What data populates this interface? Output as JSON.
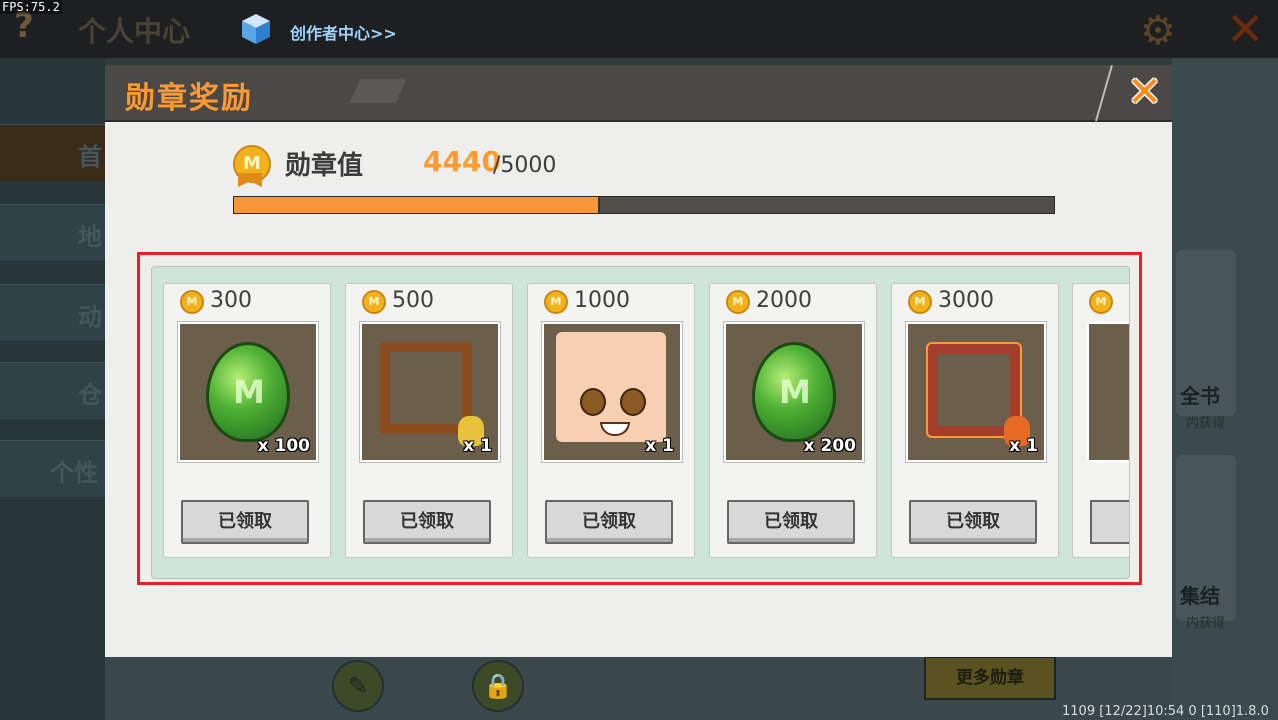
{
  "fps": "FPS:75.2",
  "top_bar": {
    "title": "个人中心",
    "creator_link": "创作者中心>>"
  },
  "background": {
    "nav_items": [
      "首",
      "地",
      "动",
      "仓",
      "个性"
    ],
    "side_cards": [
      {
        "label": "全书",
        "sub": "内获得"
      },
      {
        "label": "集结",
        "sub": "内获得"
      }
    ],
    "more_medals_button": "更多勋章",
    "version_text": "1109  [12/22]10:54 0  [110]1.8.0"
  },
  "dialog": {
    "title": "勋章奖励",
    "medal_label": "勋章值",
    "current_value": "4440",
    "max_value": "/5000",
    "progress": 0.444,
    "rewards": [
      {
        "cost": "300",
        "item": "green-egg",
        "quantity": "x 100",
        "button": "已领取"
      },
      {
        "cost": "500",
        "item": "wood-frame",
        "quantity": "x 1",
        "button": "已领取"
      },
      {
        "cost": "1000",
        "item": "face-avatar",
        "quantity": "x 1",
        "button": "已领取"
      },
      {
        "cost": "2000",
        "item": "green-egg",
        "quantity": "x 200",
        "button": "已领取"
      },
      {
        "cost": "3000",
        "item": "lava-frame",
        "quantity": "x 1",
        "button": "已领取"
      }
    ]
  },
  "colors": {
    "accent_orange": "#ff9933",
    "progress_fill": "#f7963a",
    "highlight_red": "#f21d1d",
    "panel_green": "#cfe4da"
  }
}
